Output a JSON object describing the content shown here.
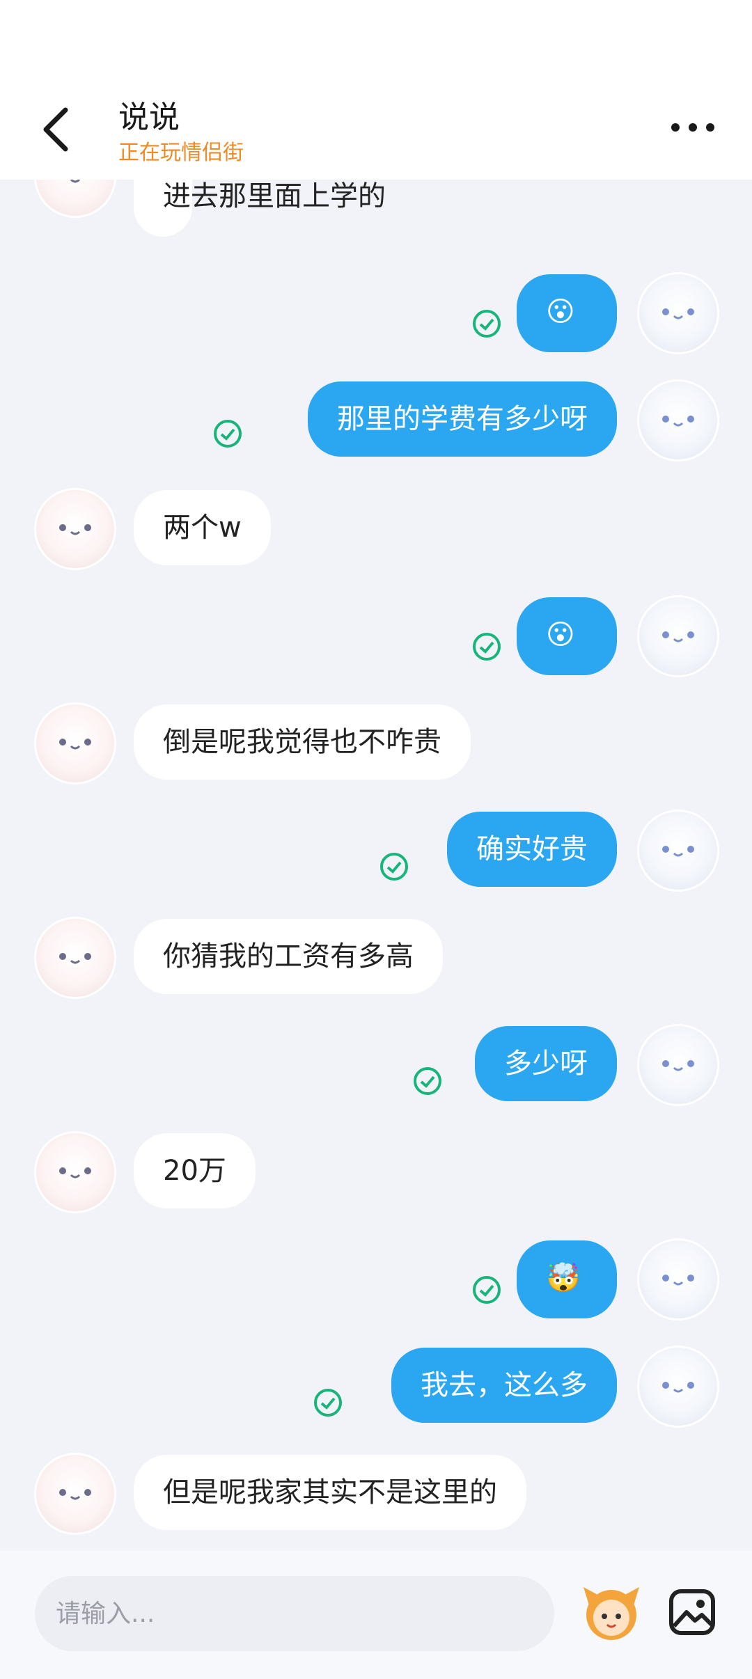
{
  "header": {
    "title": "说说",
    "subtitle": "正在玩情侣街"
  },
  "messages": [
    {
      "side": "in",
      "text": "进去那里面上学的"
    },
    {
      "side": "out",
      "emoji": "😮",
      "icon": "surprised-face-emoji"
    },
    {
      "side": "out",
      "text": "那里的学费有多少呀"
    },
    {
      "side": "in",
      "text": "两个w"
    },
    {
      "side": "out",
      "emoji": "😮",
      "icon": "surprised-face-emoji"
    },
    {
      "side": "in",
      "text": "倒是呢我觉得也不咋贵"
    },
    {
      "side": "out",
      "text": "确实好贵"
    },
    {
      "side": "in",
      "text": "你猜我的工资有多高"
    },
    {
      "side": "out",
      "text": "多少呀"
    },
    {
      "side": "in",
      "text": "20万"
    },
    {
      "side": "out",
      "emoji": "🤯",
      "icon": "exploding-head-emoji"
    },
    {
      "side": "out",
      "text": "我去，这么多"
    },
    {
      "side": "in",
      "text": "但是呢我家其实不是这里的"
    }
  ],
  "input": {
    "placeholder": "请输入..."
  },
  "colors": {
    "accent": "#2aa7f0",
    "subtitle": "#f08a24",
    "check": "#18b57a"
  }
}
